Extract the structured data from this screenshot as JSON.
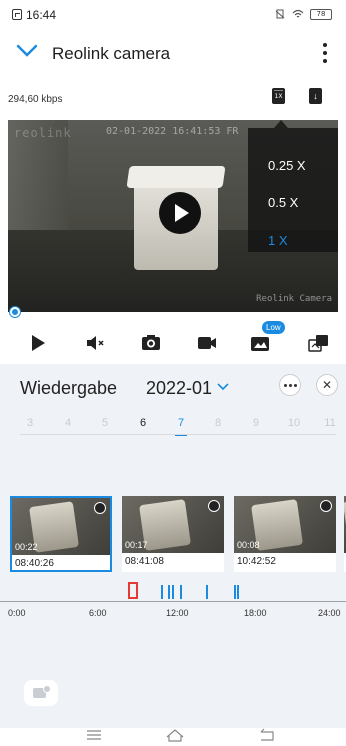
{
  "status": {
    "time": "16:44",
    "battery": "78"
  },
  "header": {
    "title": "Reolink camera"
  },
  "stream": {
    "bitrate": "294,60 kbps",
    "speed_button": "1X"
  },
  "video": {
    "watermark_left": "reolink",
    "timestamp": "02-01-2022 16:41:53 FR",
    "watermark_right": "Reolink Camera",
    "speed_options": [
      "0.25 X",
      "0.5 X",
      "1 X"
    ],
    "selected_speed": "1 X"
  },
  "controls": {
    "low_badge": "Low"
  },
  "playback": {
    "title": "Wiedergabe",
    "month": "2022-01",
    "days": [
      "3",
      "4",
      "5",
      "6",
      "7",
      "8",
      "9",
      "10",
      "11"
    ],
    "selected_day": "7",
    "clips": [
      {
        "duration": "00:22",
        "time": "08:40:26"
      },
      {
        "duration": "00:17",
        "time": "08:41:08"
      },
      {
        "duration": "00:08",
        "time": "10:42:52"
      }
    ],
    "timeline_labels": [
      "0:00",
      "6:00",
      "12:00",
      "18:00",
      "24:00"
    ]
  },
  "colors": {
    "accent": "#1a8be0",
    "cursor": "#e53935",
    "panel_bg": "#eff2f7"
  }
}
